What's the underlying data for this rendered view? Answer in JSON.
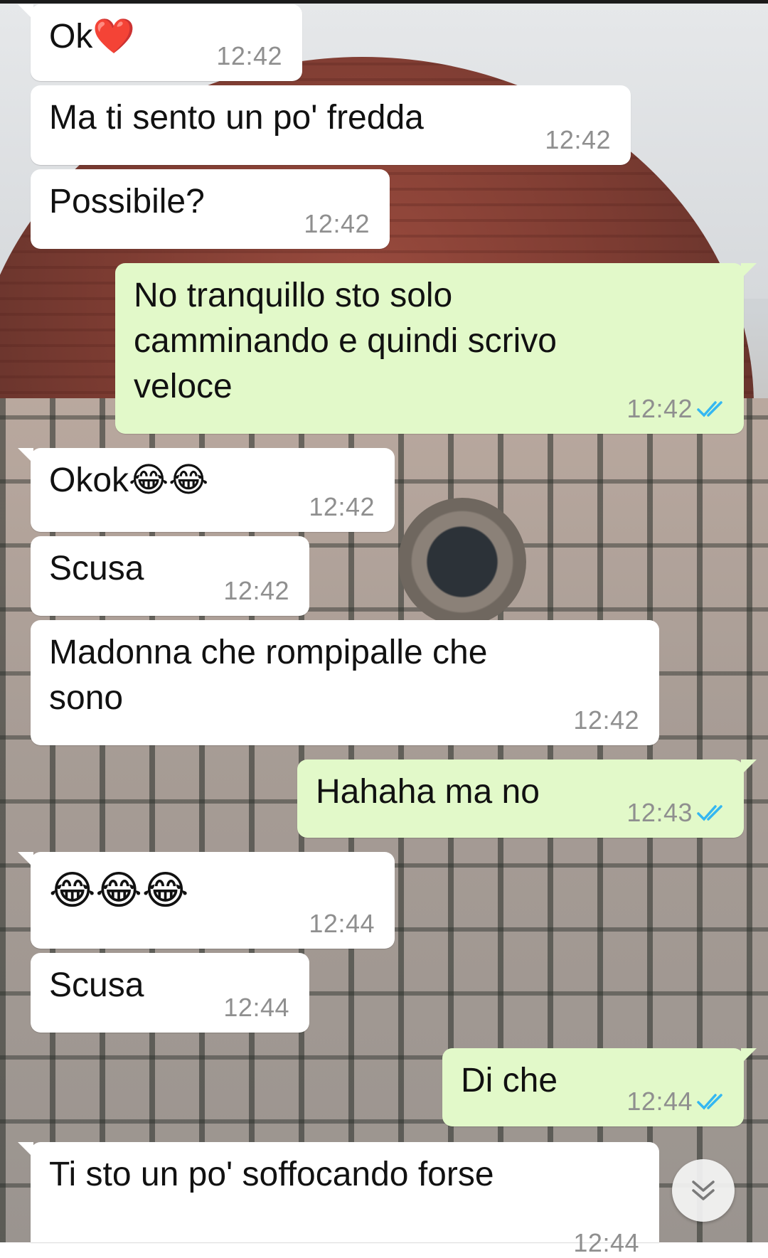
{
  "chat": {
    "messages": [
      {
        "direction": "in",
        "text": "Ok❤️",
        "time": "12:42"
      },
      {
        "direction": "in",
        "text": "Ma ti sento un po' fredda",
        "time": "12:42"
      },
      {
        "direction": "in",
        "text": "Possibile?",
        "time": "12:42"
      },
      {
        "direction": "out",
        "text": "No tranquillo sto solo camminando e quindi scrivo veloce",
        "time": "12:42",
        "status": "read"
      },
      {
        "direction": "in",
        "text": "Okok😂😂",
        "time": "12:42"
      },
      {
        "direction": "in",
        "text": "Scusa",
        "time": "12:42"
      },
      {
        "direction": "in",
        "text": "Madonna che rompipalle che sono",
        "time": "12:42"
      },
      {
        "direction": "out",
        "text": "Hahaha ma no",
        "time": "12:43",
        "status": "read"
      },
      {
        "direction": "in",
        "text": "😂😂😂",
        "time": "12:44"
      },
      {
        "direction": "in",
        "text": "Scusa",
        "time": "12:44"
      },
      {
        "direction": "out",
        "text": "Di che",
        "time": "12:44",
        "status": "read"
      },
      {
        "direction": "in",
        "text": "Ti sto un po' soffocando forse",
        "time": "12:44"
      }
    ]
  },
  "colors": {
    "incoming_bubble": "#ffffff",
    "outgoing_bubble": "#e2f9c9",
    "read_ticks": "#34b7f1",
    "timestamp": "#8f8f8f"
  },
  "icons": {
    "read_receipt": "double-check-icon",
    "scroll_down": "chevron-double-down-icon"
  }
}
